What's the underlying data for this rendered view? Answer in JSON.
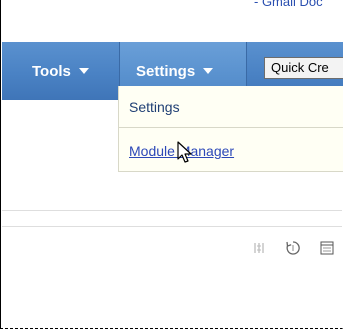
{
  "header": {
    "top_link": "- Gmail Doc"
  },
  "navbar": {
    "tools_label": "Tools",
    "settings_label": "Settings",
    "quick_create_label": "Quick Cre"
  },
  "dropdown": {
    "items": [
      {
        "label": "Settings"
      },
      {
        "label": "Module Manager"
      }
    ]
  },
  "toolbar": {
    "icons": [
      "columns-icon",
      "refresh-icon",
      "layout-icon"
    ]
  },
  "colors": {
    "nav_blue": "#4a82c4",
    "link_blue": "#2c48b8",
    "dropdown_bg": "#fffff4"
  }
}
